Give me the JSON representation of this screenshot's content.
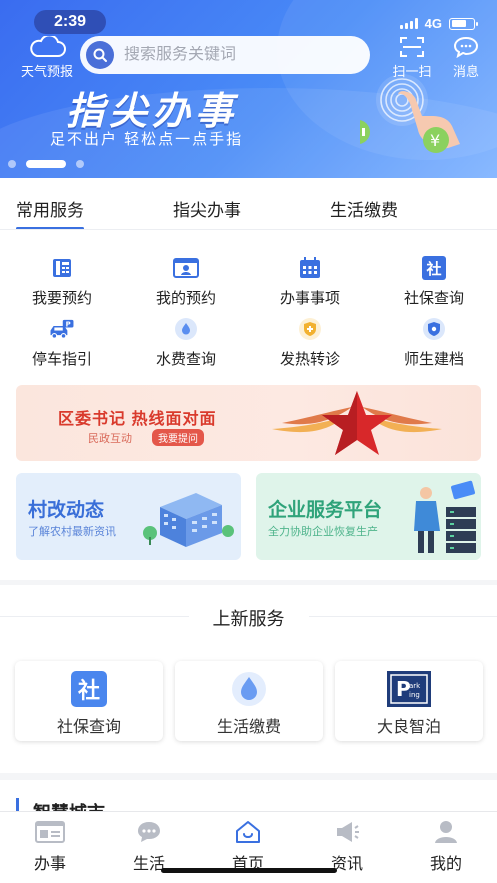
{
  "status_bar": {
    "time": "2:39",
    "network": "4G"
  },
  "header": {
    "weather_label": "天气预报",
    "search_placeholder": "搜索服务关键词",
    "scan_label": "扫一扫",
    "message_label": "消息"
  },
  "banner": {
    "title": "指尖办事",
    "subtitle": "足不出户 轻松点一点手指",
    "slide_count": 3,
    "active_slide": 2
  },
  "tabs": [
    {
      "label": "常用服务",
      "active": true
    },
    {
      "label": "指尖办事",
      "active": false
    },
    {
      "label": "生活缴费",
      "active": false
    }
  ],
  "services": [
    {
      "label": "我要预约",
      "icon": "phone-booth-icon"
    },
    {
      "label": "我的预约",
      "icon": "id-card-icon"
    },
    {
      "label": "办事事项",
      "icon": "calendar-icon"
    },
    {
      "label": "社保查询",
      "icon": "social-security-icon"
    },
    {
      "label": "停车指引",
      "icon": "parking-car-icon"
    },
    {
      "label": "水费查询",
      "icon": "water-drop-icon"
    },
    {
      "label": "发热转诊",
      "icon": "medical-badge-icon"
    },
    {
      "label": "师生建档",
      "icon": "shield-icon"
    }
  ],
  "promo": {
    "title": "区委书记  热线面对面",
    "subtitle": "民政互动",
    "button": "我要提问"
  },
  "cards": [
    {
      "title": "村改动态",
      "subtitle": "了解农村最新资讯",
      "color": "#3a6fd8",
      "bg": "#e3eefb"
    },
    {
      "title": "企业服务平台",
      "subtitle": "全力协助企业恢复生产",
      "color": "#2fa37a",
      "bg": "#dff4ea"
    }
  ],
  "new_services": {
    "title": "上新服务",
    "items": [
      {
        "label": "社保查询",
        "icon": "social-security-icon"
      },
      {
        "label": "生活缴费",
        "icon": "water-drop-icon"
      },
      {
        "label": "大良智泊",
        "icon": "parking-logo-icon"
      }
    ]
  },
  "smart_city": {
    "title": "智慧城市"
  },
  "bottom_nav": [
    {
      "label": "办事",
      "icon": "id-card-icon"
    },
    {
      "label": "生活",
      "icon": "chat-bubble-icon"
    },
    {
      "label": "首页",
      "icon": "home-icon",
      "active": true
    },
    {
      "label": "资讯",
      "icon": "megaphone-icon"
    },
    {
      "label": "我的",
      "icon": "person-icon"
    }
  ],
  "colors": {
    "accent": "#3a70e0",
    "banner": "#4a8cf7",
    "promo_red": "#d93a2c"
  }
}
